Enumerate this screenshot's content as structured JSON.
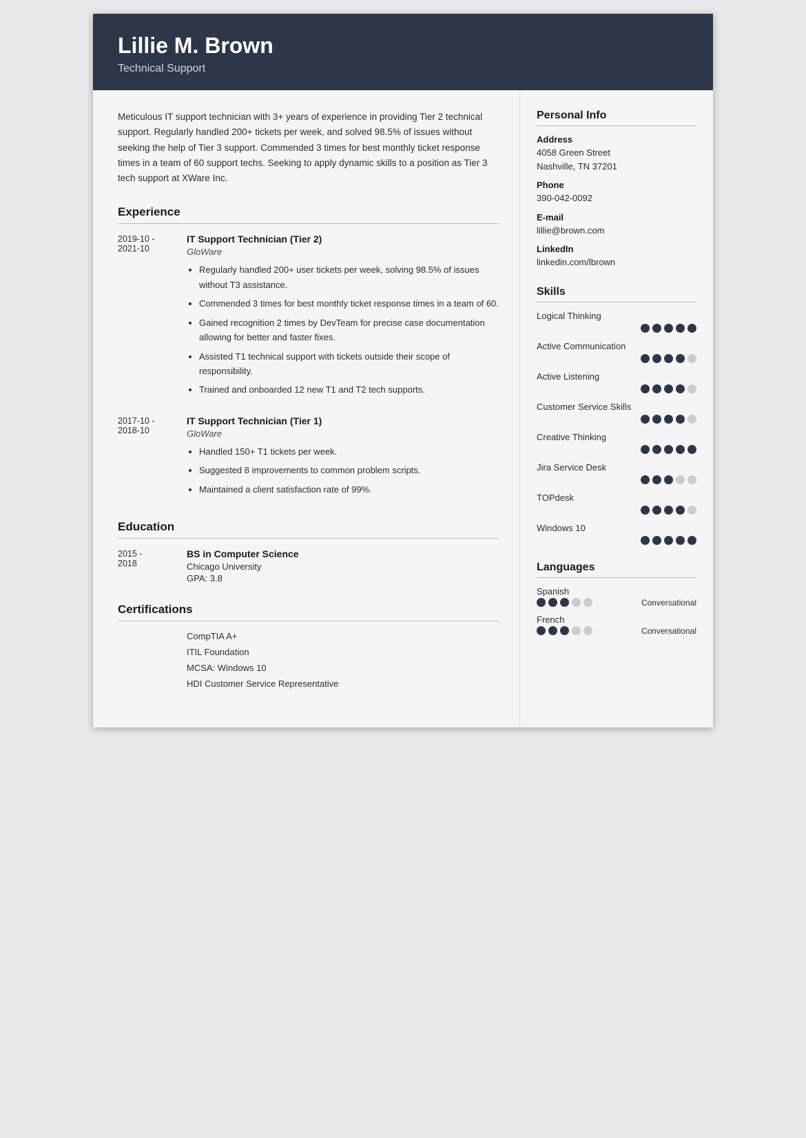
{
  "header": {
    "name": "Lillie M. Brown",
    "title": "Technical Support"
  },
  "summary": "Meticulous IT support technician with 3+ years of experience in providing Tier 2 technical support. Regularly handled 200+ tickets per week, and solved 98.5% of issues without seeking the help of Tier 3 support. Commended 3 times for best monthly ticket response times in a team of 60 support techs. Seeking to apply dynamic skills to a position as Tier 3 tech support at XWare Inc.",
  "sections": {
    "experience_title": "Experience",
    "education_title": "Education",
    "certifications_title": "Certifications"
  },
  "experience": [
    {
      "date_start": "2019-10 -",
      "date_end": "2021-10",
      "title": "IT Support Technician (Tier 2)",
      "company": "GloWare",
      "bullets": [
        "Regularly handled 200+ user tickets per week, solving 98.5% of issues without T3 assistance.",
        "Commended 3 times for best monthly ticket response times in a team of 60.",
        "Gained recognition 2 times by DevTeam for precise case documentation allowing for better and faster fixes.",
        "Assisted T1 technical support with tickets outside their scope of responsibility.",
        "Trained and onboarded 12 new T1 and T2 tech supports."
      ]
    },
    {
      "date_start": "2017-10 -",
      "date_end": "2018-10",
      "title": "IT Support Technician (Tier 1)",
      "company": "GloWare",
      "bullets": [
        "Handled 150+ T1 tickets per week.",
        "Suggested 8 improvements to common problem scripts.",
        "Maintained a client satisfaction rate of 99%."
      ]
    }
  ],
  "education": [
    {
      "date_start": "2015 -",
      "date_end": "2018",
      "degree": "BS in Computer Science",
      "school": "Chicago University",
      "gpa": "GPA: 3.8"
    }
  ],
  "certifications": [
    "CompTIA A+",
    "ITIL Foundation",
    "MCSA: Windows 10",
    "HDI Customer Service Representative"
  ],
  "sidebar": {
    "personal_info_title": "Personal Info",
    "address_label": "Address",
    "address_line1": "4058 Green Street",
    "address_line2": "Nashville, TN 37201",
    "phone_label": "Phone",
    "phone_value": "390-042-0092",
    "email_label": "E-mail",
    "email_value": "lillie@brown.com",
    "linkedin_label": "LinkedIn",
    "linkedin_value": "linkedin.com/lbrown",
    "skills_title": "Skills",
    "skills": [
      {
        "name": "Logical Thinking",
        "filled": 5,
        "empty": 0
      },
      {
        "name": "Active Communication",
        "filled": 4,
        "empty": 1
      },
      {
        "name": "Active Listening",
        "filled": 4,
        "empty": 1
      },
      {
        "name": "Customer Service Skills",
        "filled": 4,
        "empty": 1
      },
      {
        "name": "Creative Thinking",
        "filled": 5,
        "empty": 0
      },
      {
        "name": "Jira Service Desk",
        "filled": 3,
        "empty": 2
      },
      {
        "name": "TOPdesk",
        "filled": 4,
        "empty": 1
      },
      {
        "name": "Windows 10",
        "filled": 5,
        "empty": 0
      }
    ],
    "languages_title": "Languages",
    "languages": [
      {
        "name": "Spanish",
        "filled": 3,
        "empty": 2,
        "level": "Conversational"
      },
      {
        "name": "French",
        "filled": 3,
        "empty": 2,
        "level": "Conversational"
      }
    ]
  }
}
